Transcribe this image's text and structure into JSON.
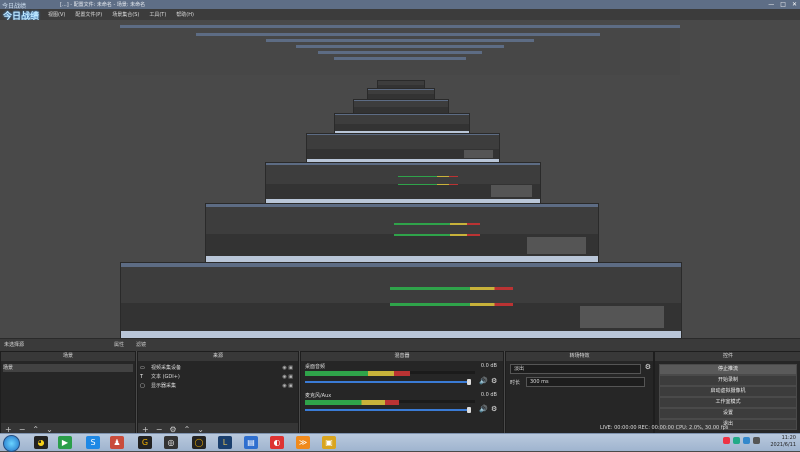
{
  "window": {
    "logo_text": "今日战绩",
    "title": "[...] - 配置文件: 未命名 - 场景: 未命名",
    "controls": [
      "—",
      "□",
      "✕"
    ]
  },
  "menu": {
    "brand": "今日战绩",
    "items": [
      "视图(V)",
      "配置文件(P)",
      "场景集合(S)",
      "工具(T)",
      "帮助(H)"
    ]
  },
  "scene_bar": {
    "label": "未选择源",
    "properties": "属性",
    "filters": "滤镜"
  },
  "docks": {
    "scenes": {
      "title": "场景",
      "items": [
        "场景"
      ]
    },
    "sources": {
      "title": "来源",
      "items": [
        {
          "icon": "camera-icon",
          "label": "视频采集设备"
        },
        {
          "icon": "text-icon",
          "label": "文本 (GDI+)"
        },
        {
          "icon": "monitor-icon",
          "label": "显示器采集"
        }
      ]
    },
    "mixer": {
      "title": "混音器",
      "channels": [
        {
          "label": "桌面音频",
          "db": "0.0 dB",
          "level": 0.62
        },
        {
          "label": "麦克风/Aux",
          "db": "0.0 dB",
          "level": 0.55
        }
      ]
    },
    "transitions": {
      "title": "转场特效",
      "selected": "淡出",
      "duration_label": "时长",
      "duration": "300 ms"
    },
    "controls": {
      "title": "控件",
      "buttons": [
        "停止推流",
        "开始录制",
        "启动虚拟摄像机",
        "工作室模式",
        "设置",
        "退出"
      ]
    }
  },
  "status": {
    "text": "LIVE: 00:00:00  REC: 00:00:00  CPU: 2.0%, 30.00 fps"
  },
  "taskbar": {
    "clock_time": "11:20",
    "clock_date": "2021/6/11"
  }
}
